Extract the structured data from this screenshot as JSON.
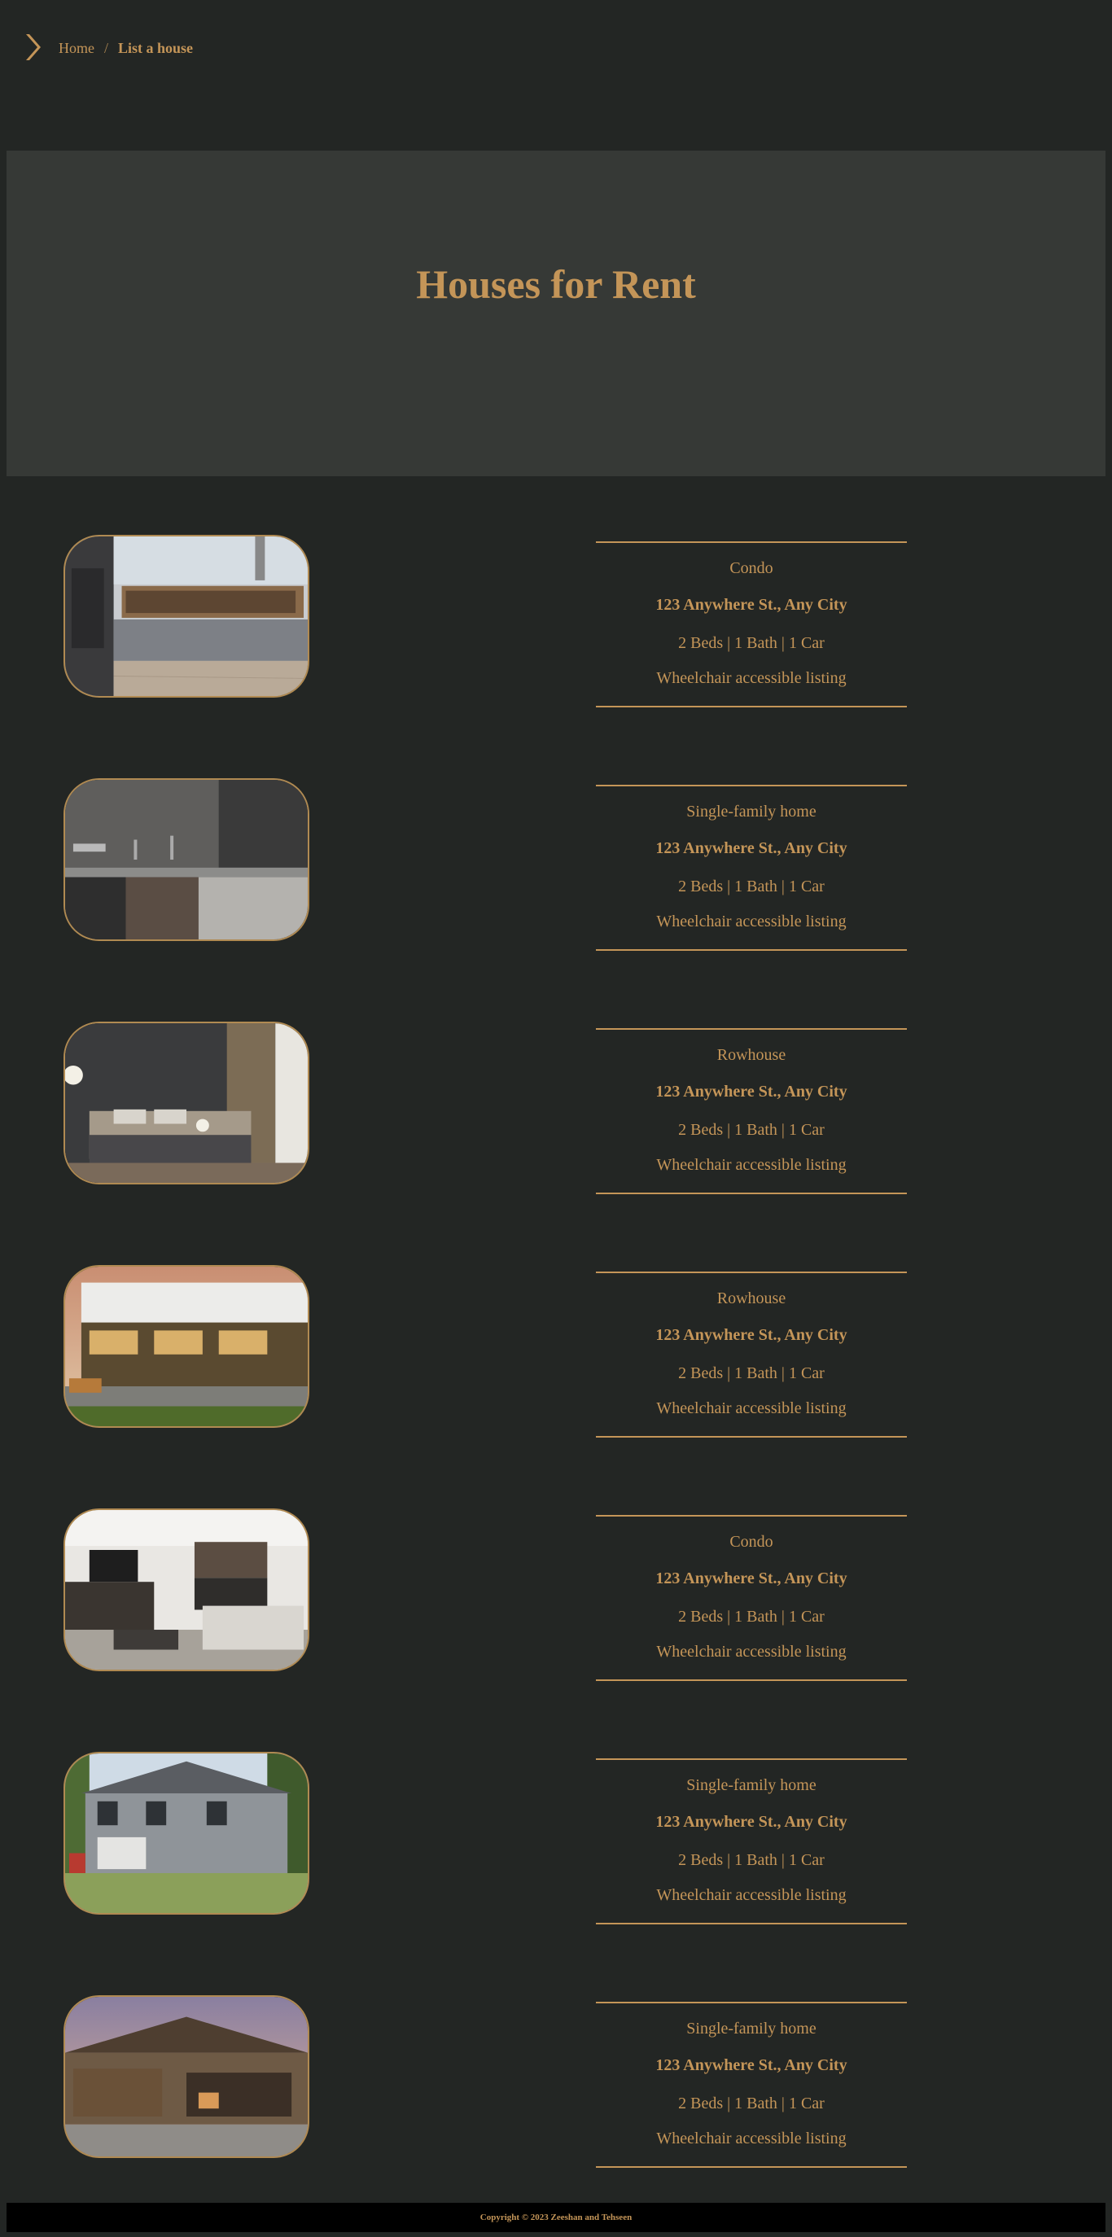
{
  "nav": {
    "logo_icon": "chevron-right-icon",
    "home_label": "Home",
    "separator": "/",
    "current_label": "List a house"
  },
  "hero": {
    "title": "Houses for Rent"
  },
  "listings": [
    {
      "type": "Condo",
      "address": "123 Anywhere St., Any City",
      "specs": "2 Beds | 1 Bath | 1 Car",
      "accessibility": "Wheelchair accessible listing",
      "image": "kitchen-photo"
    },
    {
      "type": "Single-family home",
      "address": "123 Anywhere St., Any City",
      "specs": "2 Beds | 1 Bath | 1 Car",
      "accessibility": "Wheelchair accessible listing",
      "image": "dark-kitchen-photo"
    },
    {
      "type": "Rowhouse",
      "address": "123 Anywhere St., Any City",
      "specs": "2 Beds | 1 Bath | 1 Car",
      "accessibility": "Wheelchair accessible listing",
      "image": "bedroom-photo"
    },
    {
      "type": "Rowhouse",
      "address": "123 Anywhere St., Any City",
      "specs": "2 Beds | 1 Bath | 1 Car",
      "accessibility": "Wheelchair accessible listing",
      "image": "rowhouse-exterior-photo"
    },
    {
      "type": "Condo",
      "address": "123 Anywhere St., Any City",
      "specs": "2 Beds | 1 Bath | 1 Car",
      "accessibility": "Wheelchair accessible listing",
      "image": "living-room-photo"
    },
    {
      "type": "Single-family home",
      "address": "123 Anywhere St., Any City",
      "specs": "2 Beds | 1 Bath | 1 Car",
      "accessibility": "Wheelchair accessible listing",
      "image": "house-exterior-photo"
    },
    {
      "type": "Single-family home",
      "address": "123 Anywhere St., Any City",
      "specs": "2 Beds | 1 Bath | 1 Car",
      "accessibility": "Wheelchair accessible listing",
      "image": "house-dusk-photo"
    }
  ],
  "footer": {
    "copyright": "Copyright © 2023 Zeeshan and Tehseen"
  }
}
